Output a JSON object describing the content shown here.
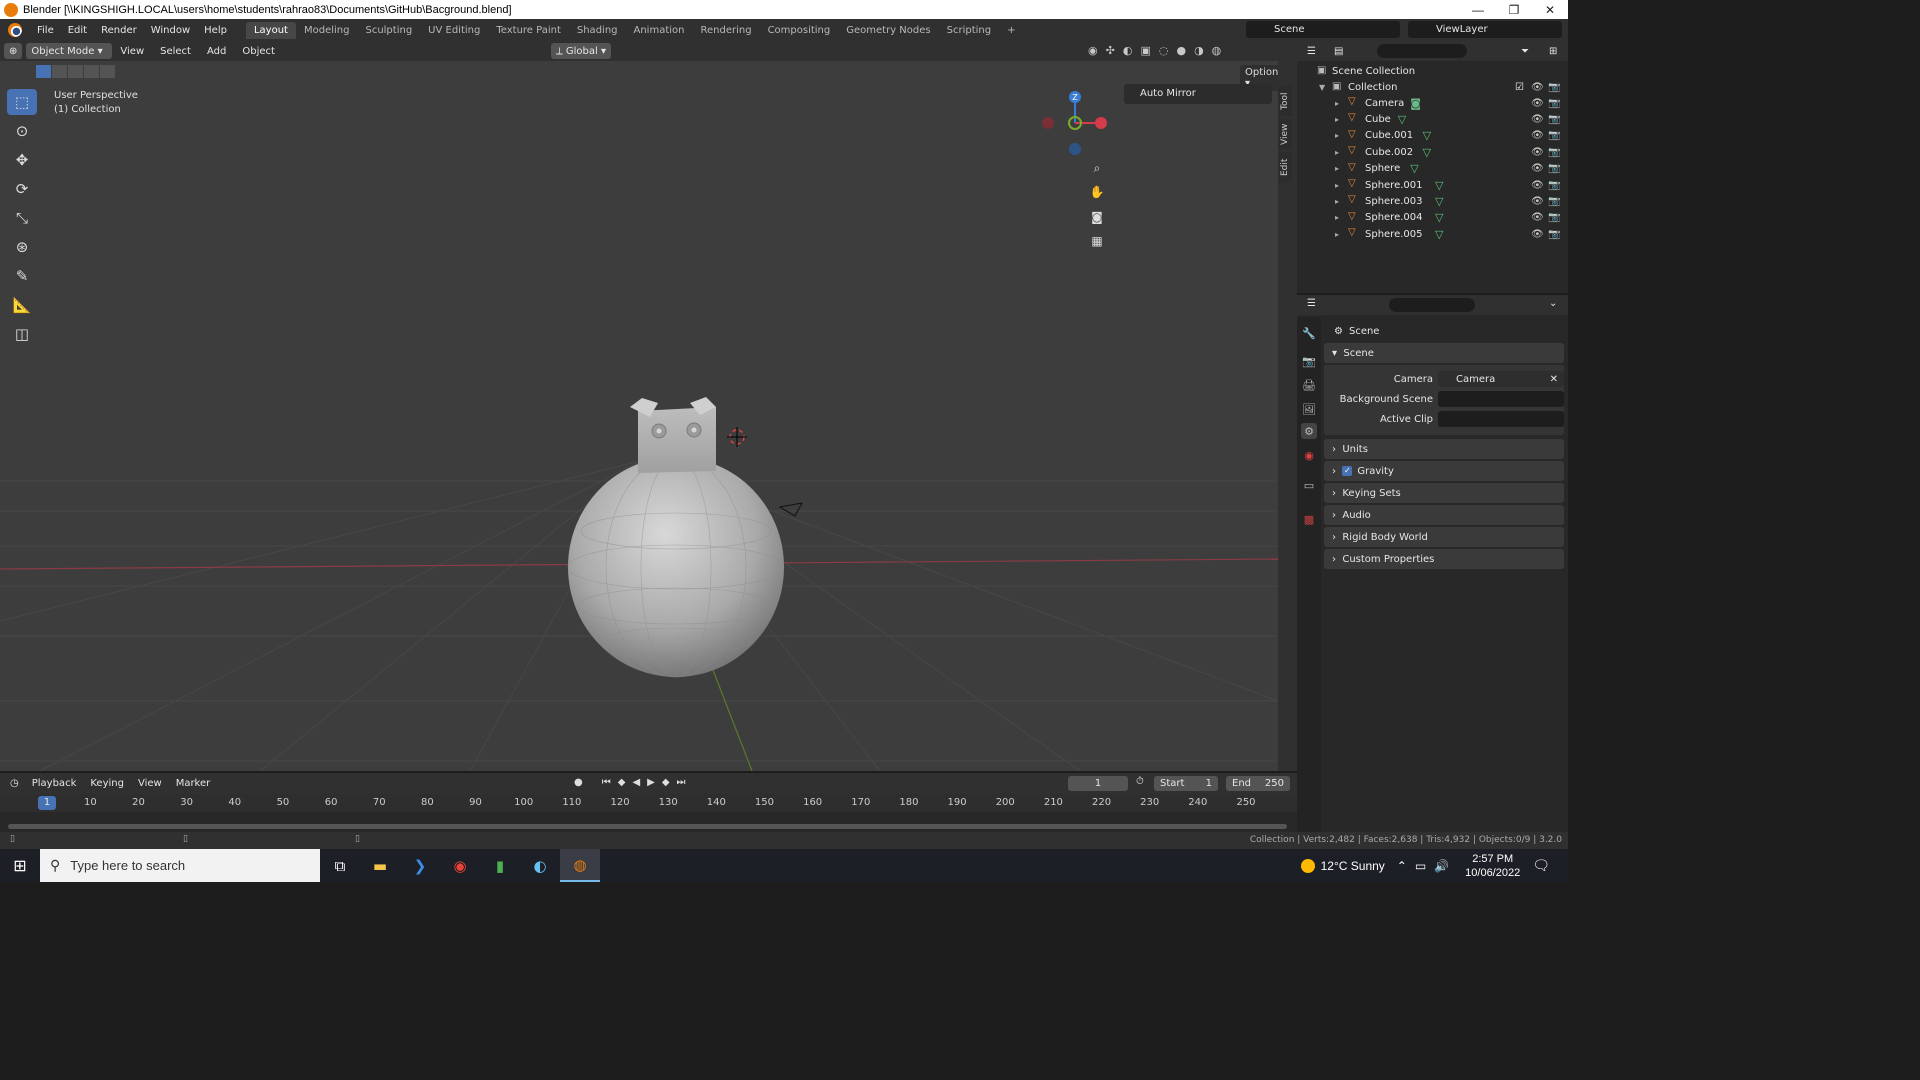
{
  "window": {
    "title": "Blender [\\\\KINGSHIGH.LOCAL\\users\\home\\students\\rahrao83\\Documents\\GitHub\\Bacground.blend]",
    "minimize": "—",
    "maximize": "❐",
    "close": "✕"
  },
  "menubar": {
    "items": [
      "File",
      "Edit",
      "Render",
      "Window",
      "Help"
    ],
    "workspaces": [
      "Layout",
      "Modeling",
      "Sculpting",
      "UV Editing",
      "Texture Paint",
      "Shading",
      "Animation",
      "Rendering",
      "Compositing",
      "Geometry Nodes",
      "Scripting",
      "+"
    ],
    "active_workspace": "Layout",
    "scene": "Scene",
    "view_layer": "ViewLayer"
  },
  "viewport_header": {
    "mode": "Object Mode",
    "menus": [
      "View",
      "Select",
      "Add",
      "Object"
    ],
    "orientation": "Global",
    "options": "Options"
  },
  "viewport": {
    "perspective_label": "User Perspective",
    "collection_label": "(1) Collection",
    "auto_mirror": "Auto Mirror",
    "npanel_tabs": [
      "Tool",
      "View",
      "Edit"
    ],
    "gizmo_z": "Z"
  },
  "outliner": {
    "root": "Scene Collection",
    "collection": "Collection",
    "objects": [
      {
        "name": "Camera",
        "type": "camera"
      },
      {
        "name": "Cube",
        "type": "mesh"
      },
      {
        "name": "Cube.001",
        "type": "mesh"
      },
      {
        "name": "Cube.002",
        "type": "mesh"
      },
      {
        "name": "Sphere",
        "type": "mesh"
      },
      {
        "name": "Sphere.001",
        "type": "mesh"
      },
      {
        "name": "Sphere.003",
        "type": "mesh"
      },
      {
        "name": "Sphere.004",
        "type": "mesh"
      },
      {
        "name": "Sphere.005",
        "type": "mesh"
      }
    ]
  },
  "properties": {
    "context": "Scene",
    "scene_panel": {
      "title": "Scene",
      "camera_label": "Camera",
      "camera_value": "Camera",
      "background_scene_label": "Background Scene",
      "active_clip_label": "Active Clip"
    },
    "panels": [
      "Units",
      "Gravity",
      "Keying Sets",
      "Audio",
      "Rigid Body World",
      "Custom Properties"
    ],
    "gravity_checked": true
  },
  "timeline": {
    "menus": [
      "Playback",
      "Keying",
      "View",
      "Marker"
    ],
    "current_frame": "1",
    "start_label": "Start",
    "start_value": "1",
    "end_label": "End",
    "end_value": "250",
    "ruler": [
      "1",
      "10",
      "20",
      "30",
      "40",
      "50",
      "60",
      "70",
      "80",
      "90",
      "100",
      "110",
      "120",
      "130",
      "140",
      "150",
      "160",
      "170",
      "180",
      "190",
      "200",
      "210",
      "220",
      "230",
      "240",
      "250"
    ]
  },
  "statusbar": {
    "stats": "Collection | Verts:2,482 | Faces:2,638 | Tris:4,932 | Objects:0/9 | 3.2.0"
  },
  "taskbar": {
    "search_placeholder": "Type here to search",
    "weather": "12°C  Sunny",
    "time": "2:57 PM",
    "date": "10/06/2022"
  },
  "colors": {
    "accent": "#4772b3",
    "x_axis": "#d43b4b",
    "y_axis": "#7bab2a",
    "z_axis": "#3a7dd6",
    "blender_orange": "#e87d0d"
  }
}
